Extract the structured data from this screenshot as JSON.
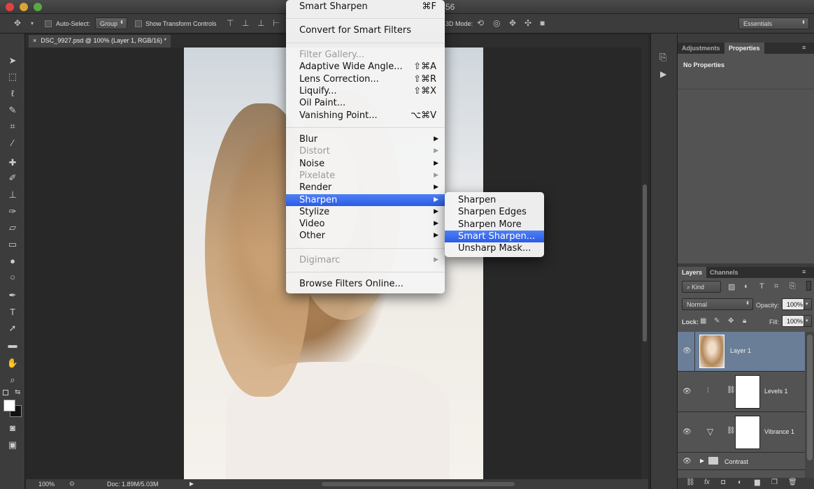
{
  "optionsbar": {
    "auto_select_label": "Auto-Select:",
    "auto_select_value": "Group",
    "transform_label": "Show Transform Controls",
    "mode_label": "3D Mode:",
    "workspace": "Essentials",
    "title_fragment": "56"
  },
  "document": {
    "tab": "DSC_9927.psd @ 100% (Layer 1, RGB/16) *",
    "zoom": "100%",
    "doc_size": "Doc: 1.89M/5.03M"
  },
  "filter_menu": {
    "last_filter": "Smart Sharpen",
    "last_filter_shortcut": "⌘F",
    "convert": "Convert for Smart Filters",
    "group2": [
      {
        "label": "Filter Gallery...",
        "shortcut": "",
        "disabled": true
      },
      {
        "label": "Adaptive Wide Angle...",
        "shortcut": "⇧⌘A",
        "disabled": false
      },
      {
        "label": "Lens Correction...",
        "shortcut": "⇧⌘R",
        "disabled": false
      },
      {
        "label": "Liquify...",
        "shortcut": "⇧⌘X",
        "disabled": false
      },
      {
        "label": "Oil Paint...",
        "shortcut": "",
        "disabled": false
      },
      {
        "label": "Vanishing Point...",
        "shortcut": "⌥⌘V",
        "disabled": false
      }
    ],
    "group3": [
      {
        "label": "Blur",
        "disabled": false
      },
      {
        "label": "Distort",
        "disabled": true
      },
      {
        "label": "Noise",
        "disabled": false
      },
      {
        "label": "Pixelate",
        "disabled": true
      },
      {
        "label": "Render",
        "disabled": false
      },
      {
        "label": "Sharpen",
        "disabled": false,
        "highlighted": true
      },
      {
        "label": "Stylize",
        "disabled": false
      },
      {
        "label": "Video",
        "disabled": false
      },
      {
        "label": "Other",
        "disabled": false
      }
    ],
    "digimarc": "Digimarc",
    "browse": "Browse Filters Online..."
  },
  "sharpen_submenu": [
    {
      "label": "Sharpen",
      "highlighted": false
    },
    {
      "label": "Sharpen Edges",
      "highlighted": false
    },
    {
      "label": "Sharpen More",
      "highlighted": false
    },
    {
      "label": "Smart Sharpen...",
      "highlighted": true
    },
    {
      "label": "Unsharp Mask...",
      "highlighted": false
    }
  ],
  "panels": {
    "tab_adjustments": "Adjustments",
    "tab_properties": "Properties",
    "no_properties": "No Properties",
    "tab_layers": "Layers",
    "tab_channels": "Channels",
    "kind": "Kind",
    "blend_mode": "Normal",
    "opacity_label": "Opacity:",
    "opacity_value": "100%",
    "lock_label": "Lock:",
    "fill_label": "Fill:",
    "fill_value": "100%"
  },
  "layers": [
    {
      "name": "Layer 1",
      "selected": true,
      "icon": "photo-thumbnail"
    },
    {
      "name": "Levels 1",
      "selected": false,
      "icon": "levels-icon"
    },
    {
      "name": "Vibrance 1",
      "selected": false,
      "icon": "vibrance-icon"
    },
    {
      "name": "Contrast",
      "selected": false,
      "icon": "folder-icon"
    }
  ]
}
